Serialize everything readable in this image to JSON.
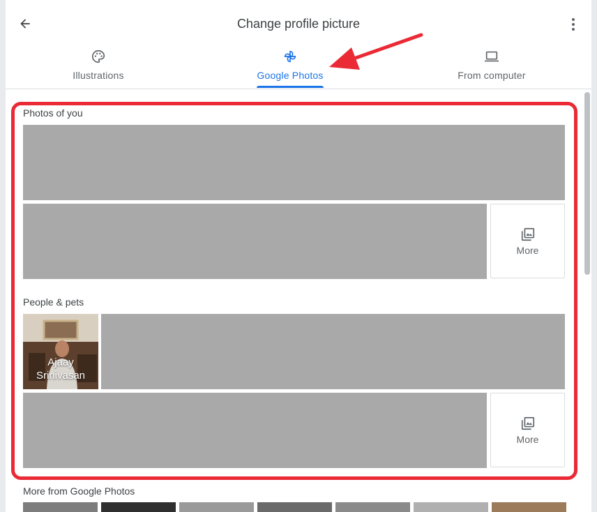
{
  "header": {
    "title": "Change profile picture",
    "tabs": [
      {
        "label": "Illustrations",
        "icon": "palette-icon",
        "active": false
      },
      {
        "label": "Google Photos",
        "icon": "pinwheel-icon",
        "active": true
      },
      {
        "label": "From computer",
        "icon": "laptop-icon",
        "active": false
      }
    ]
  },
  "sections": {
    "photos_of_you": {
      "title": "Photos of you",
      "more_label": "More"
    },
    "people_pets": {
      "title": "People & pets",
      "person_name": "Ajaay Srinivasan",
      "more_label": "More"
    },
    "more_from": {
      "title": "More from Google Photos"
    }
  },
  "colors": {
    "accent": "#1a73e8",
    "highlight": "#ea2a35",
    "placeholder": "#a9a9a9"
  }
}
